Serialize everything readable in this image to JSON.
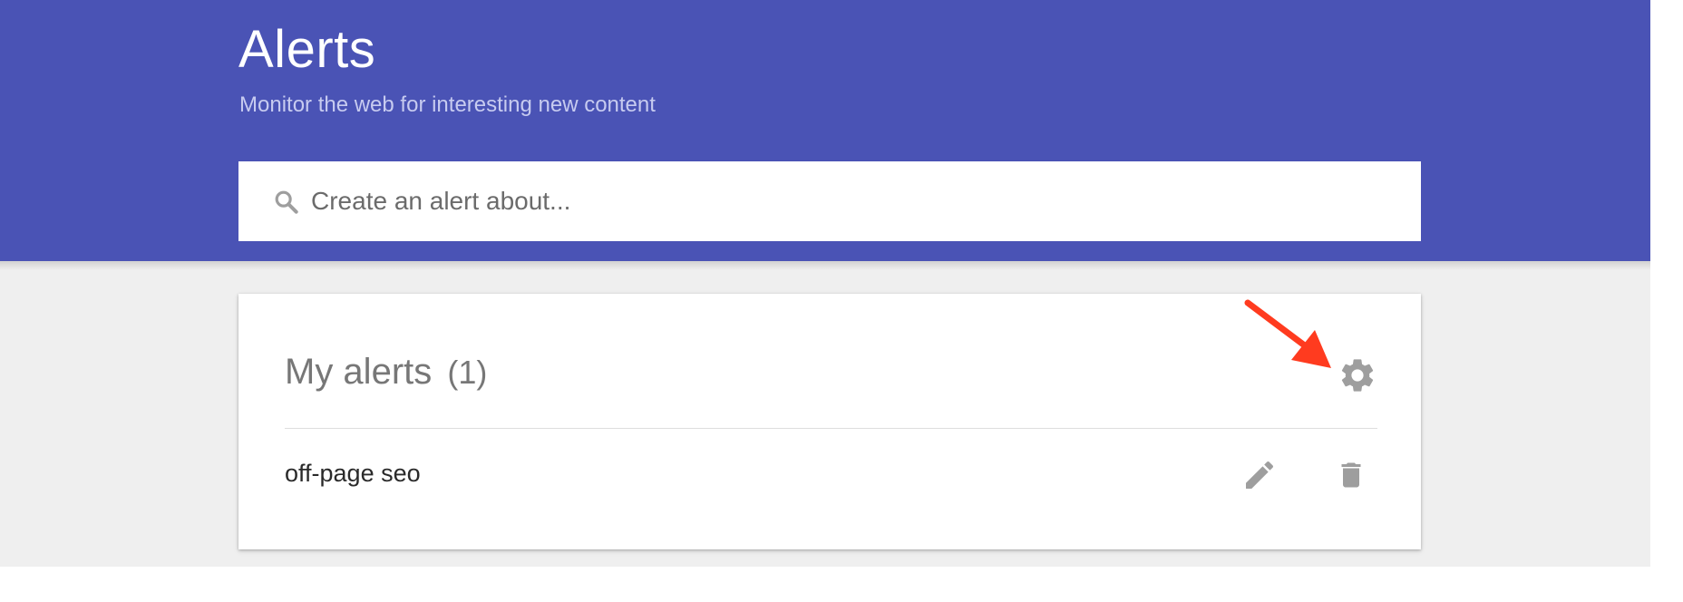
{
  "header": {
    "title": "Alerts",
    "subtitle": "Monitor the web for interesting new content"
  },
  "search": {
    "placeholder": "Create an alert about...",
    "value": "",
    "icon": "search-icon"
  },
  "my_alerts": {
    "title": "My alerts",
    "count": "(1)",
    "settings_icon": "gear-icon",
    "alerts": [
      {
        "query": "off-page seo",
        "edit_icon": "pencil-icon",
        "delete_icon": "trash-icon"
      }
    ]
  },
  "colors": {
    "header_bg": "#4a53b5",
    "content_bg": "#efefef",
    "annotation_arrow": "#ff3b1f",
    "icon_gray": "#9e9e9e"
  }
}
